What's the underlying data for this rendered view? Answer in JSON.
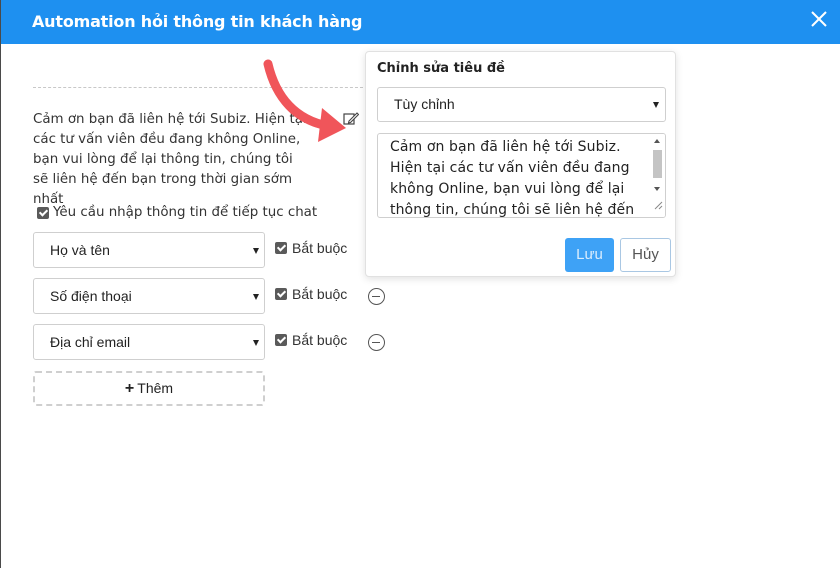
{
  "dialog": {
    "title": "Automation hỏi thông tin khách hàng"
  },
  "greeting_message": "Cảm ơn bạn đã liên hệ tới Subiz. Hiện tại các tư vấn viên đều đang không Online, bạn vui lòng để lại thông tin, chúng tôi sẽ liên hệ đến bạn trong thời gian sớm nhất",
  "require_info": {
    "label": "Yêu cầu nhập thông tin để tiếp tục chat",
    "checked": true
  },
  "fields": [
    {
      "selected": "Họ và tên",
      "required_label": "Bắt buộc",
      "required": true,
      "removable": false
    },
    {
      "selected": "Số điện thoại",
      "required_label": "Bắt buộc",
      "required": true,
      "removable": true
    },
    {
      "selected": "Địa chỉ email",
      "required_label": "Bắt buộc",
      "required": true,
      "removable": true
    }
  ],
  "add_button": {
    "label": "Thêm"
  },
  "popover": {
    "title": "Chỉnh sửa tiêu đề",
    "select_value": "Tùy chỉnh",
    "textarea_value": "Cảm ơn bạn đã liên hệ tới Subiz. Hiện tại các tư vấn viên đều đang không Online, bạn vui lòng để lại thông tin, chúng tôi sẽ liên hệ đến",
    "save_label": "Lưu",
    "cancel_label": "Hủy"
  },
  "icons": {
    "close": "close-icon",
    "edit": "edit-pencil-icon",
    "arrow": "red-curved-arrow-icon",
    "remove": "minus-circle-icon",
    "add": "plus-icon"
  },
  "colors": {
    "header_bg": "#1e90f0",
    "save_button": "#3ea2f6",
    "arrow": "#f0555a"
  }
}
